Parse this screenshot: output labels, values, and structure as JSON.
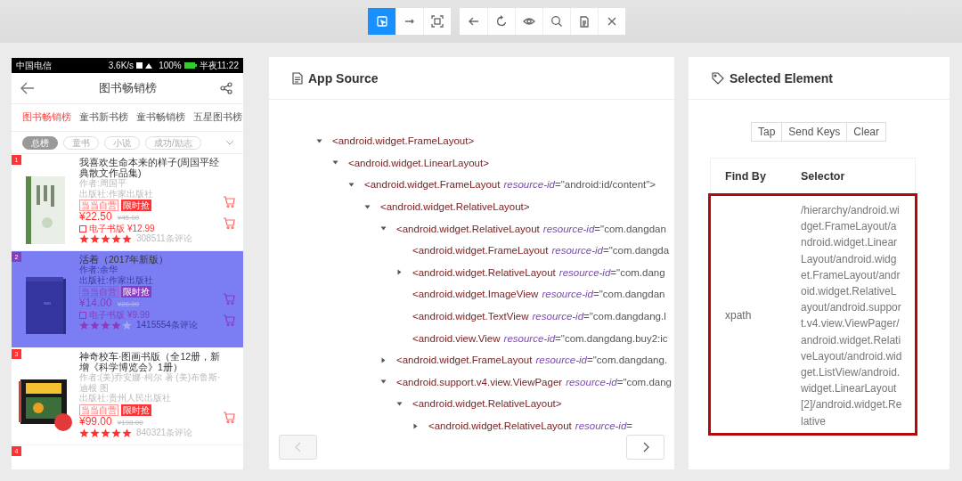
{
  "toolbar": {
    "groups": [
      {
        "buttons": [
          {
            "kind": "select",
            "selected": true
          },
          {
            "kind": "swipe",
            "selected": false
          },
          {
            "kind": "tap-region",
            "selected": false
          }
        ]
      },
      {
        "buttons": [
          {
            "kind": "back"
          },
          {
            "kind": "refresh"
          },
          {
            "kind": "eye"
          },
          {
            "kind": "search"
          },
          {
            "kind": "clipboard"
          },
          {
            "kind": "close"
          }
        ]
      }
    ]
  },
  "device": {
    "status_bar": {
      "carrier": "中国电信",
      "speed": "3.6K/s",
      "battery": "100%",
      "time": "半夜11:22"
    },
    "header": {
      "title": "图书畅销榜"
    },
    "tabs": [
      {
        "label": "图书畅销榜",
        "selected": true
      },
      {
        "label": "童书新书榜",
        "selected": false
      },
      {
        "label": "童书畅销榜",
        "selected": false
      },
      {
        "label": "五星图书榜",
        "selected": false
      }
    ],
    "chips": [
      {
        "label": "总榜",
        "selected": true
      },
      {
        "label": "童书",
        "selected": false
      },
      {
        "label": "小说",
        "selected": false
      },
      {
        "label": "成功/励志",
        "selected": false
      }
    ],
    "books": [
      {
        "rank": "1",
        "selected": false,
        "title": "我喜欢生命本来的样子(周国平经典散文作品集)",
        "author": "作者:周国平",
        "publisher": "出版社:作家出版社",
        "tags": [
          {
            "label": "当当自营",
            "kind": "outline"
          },
          {
            "label": "限时抢",
            "kind": "filled"
          }
        ],
        "price": "¥22.50",
        "list_price": "¥45.00",
        "ebook": {
          "label": "电子书版",
          "price": "¥12.99"
        },
        "stars": 5,
        "reviews": "308511条评论"
      },
      {
        "rank": "2",
        "selected": true,
        "title": "活着（2017年新版）",
        "author": "作者:余华",
        "publisher": "出版社:作家出版社",
        "tags": [
          {
            "label": "当当自营",
            "kind": "outline"
          },
          {
            "label": "限时抢",
            "kind": "filled"
          }
        ],
        "price": "¥14.00",
        "list_price": "¥28.00",
        "ebook": {
          "label": "电子书版",
          "price": "¥9.99"
        },
        "stars": 4,
        "reviews": "1415554条评论"
      },
      {
        "rank": "3",
        "selected": false,
        "title": "神奇校车·图画书版（全12册，新增《科学博览会》1册）",
        "author": "作者:(美)乔安娜·柯尔 著 (美)布鲁斯·迪根 图",
        "publisher": "出版社:贵州人民出版社",
        "tags": [
          {
            "label": "当当自营",
            "kind": "outline"
          },
          {
            "label": "限时抢",
            "kind": "filled"
          }
        ],
        "price": "¥99.00",
        "list_price": "¥198.00",
        "stars": 5,
        "reviews": "840321条评论"
      }
    ],
    "next_rank": "4"
  },
  "source": {
    "title": "App Source",
    "tree": [
      {
        "open": "<android.widget.FrameLayout>",
        "kind": "branch",
        "expanded": true,
        "children": [
          {
            "open": "<android.widget.LinearLayout>",
            "kind": "branch",
            "expanded": true,
            "children": [
              {
                "open": "<android.widget.FrameLayout",
                "attribute": "resource-id",
                "value": "=\"android:id/content\">",
                "kind": "branch",
                "expanded": true,
                "children": [
                  {
                    "open": "<android.widget.RelativeLayout>",
                    "kind": "branch",
                    "expanded": true,
                    "children": [
                      {
                        "open": "<android.widget.RelativeLayout",
                        "attribute": "resource-id",
                        "value": "=\"com.dangdan",
                        "kind": "branch",
                        "expanded": true,
                        "children": [
                          {
                            "open": "<android.widget.FrameLayout",
                            "attribute": "resource-id",
                            "value": "=\"com.dangda",
                            "kind": "leaf"
                          },
                          {
                            "open": "<android.widget.RelativeLayout",
                            "attribute": "resource-id",
                            "value": "=\"com.dang",
                            "kind": "branch",
                            "expanded": false
                          },
                          {
                            "open": "<android.widget.ImageView",
                            "attribute": "resource-id",
                            "value": "=\"com.dangdan",
                            "kind": "leaf"
                          },
                          {
                            "open": "<android.widget.TextView",
                            "attribute": "resource-id",
                            "value": "=\"com.dangdang.l",
                            "kind": "leaf"
                          },
                          {
                            "open": "<android.view.View",
                            "attribute": "resource-id",
                            "value": "=\"com.dangdang.buy2:ic",
                            "kind": "leaf"
                          }
                        ]
                      },
                      {
                        "open": "<android.widget.FrameLayout",
                        "attribute": "resource-id",
                        "value": "=\"com.dangdang.",
                        "kind": "branch",
                        "expanded": false
                      },
                      {
                        "open": "<android.support.v4.view.ViewPager",
                        "attribute": "resource-id",
                        "value": "=\"com.dang",
                        "kind": "branch",
                        "expanded": true,
                        "children": [
                          {
                            "open": "<android.widget.RelativeLayout>",
                            "kind": "branch",
                            "expanded": true,
                            "children": [
                              {
                                "open": "<android.widget.RelativeLayout",
                                "attribute": "resource-id",
                                "value": "=",
                                "kind": "branch",
                                "expanded": false
                              }
                            ]
                          }
                        ]
                      }
                    ]
                  }
                ]
              }
            ]
          }
        ]
      }
    ],
    "pager": [
      {
        "kind": "prev",
        "disabled": true
      },
      {
        "kind": "next",
        "disabled": false
      }
    ]
  },
  "selected_element": {
    "title": "Selected Element",
    "actions": [
      "Tap",
      "Send Keys",
      "Clear"
    ],
    "table": {
      "columns": [
        "Find By",
        "Selector"
      ],
      "rows": [
        {
          "find_by": "xpath",
          "selector": "/hierarchy/android.widget.FrameLayout/android.widget.LinearLayout/android.widget.FrameLayout/android.widget.RelativeLayout/android.support.v4.view.ViewPager/android.widget.RelativeLayout/android.widget.ListView/android.widget.LinearLayout[2]/android.widget.Relative",
          "selected": true
        }
      ]
    }
  }
}
